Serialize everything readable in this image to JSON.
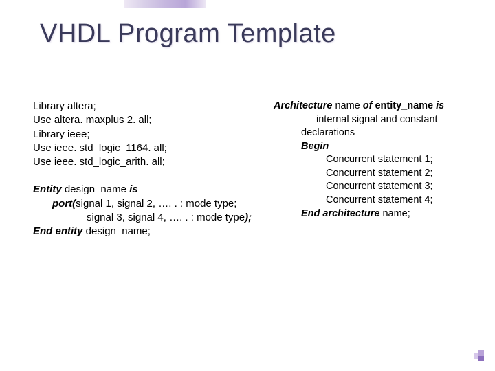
{
  "title": "VHDL Program Template",
  "left": {
    "libs": [
      "Library altera;",
      "Use altera. maxplus 2. all;",
      "Library ieee;",
      "Use ieee. std_logic_1164. all;",
      "Use ieee. std_logic_arith. all;"
    ],
    "entity_kw": "Entity",
    "entity_name": " design_name ",
    "entity_is": "is",
    "port_kw": "port(",
    "port_line1_rest": "signal 1, signal 2, …. . : mode type;",
    "port_line2": "signal 3, signal 4, …. . : mode type",
    "port_close": ");",
    "end_kw": "End entity",
    "end_name": " design_name;"
  },
  "right": {
    "arch_kw": "Architecture",
    "arch_mid": " name ",
    "arch_of": "of",
    "arch_ent": " entity_name ",
    "arch_is": "is",
    "decl1": "internal signal and constant",
    "decl2": "declarations",
    "begin": "Begin",
    "stmts": [
      "Concurrent statement 1;",
      "Concurrent statement 2;",
      "Concurrent statement 3;",
      "Concurrent statement 4;"
    ],
    "end": "End architecture",
    "end_name": " name;"
  }
}
